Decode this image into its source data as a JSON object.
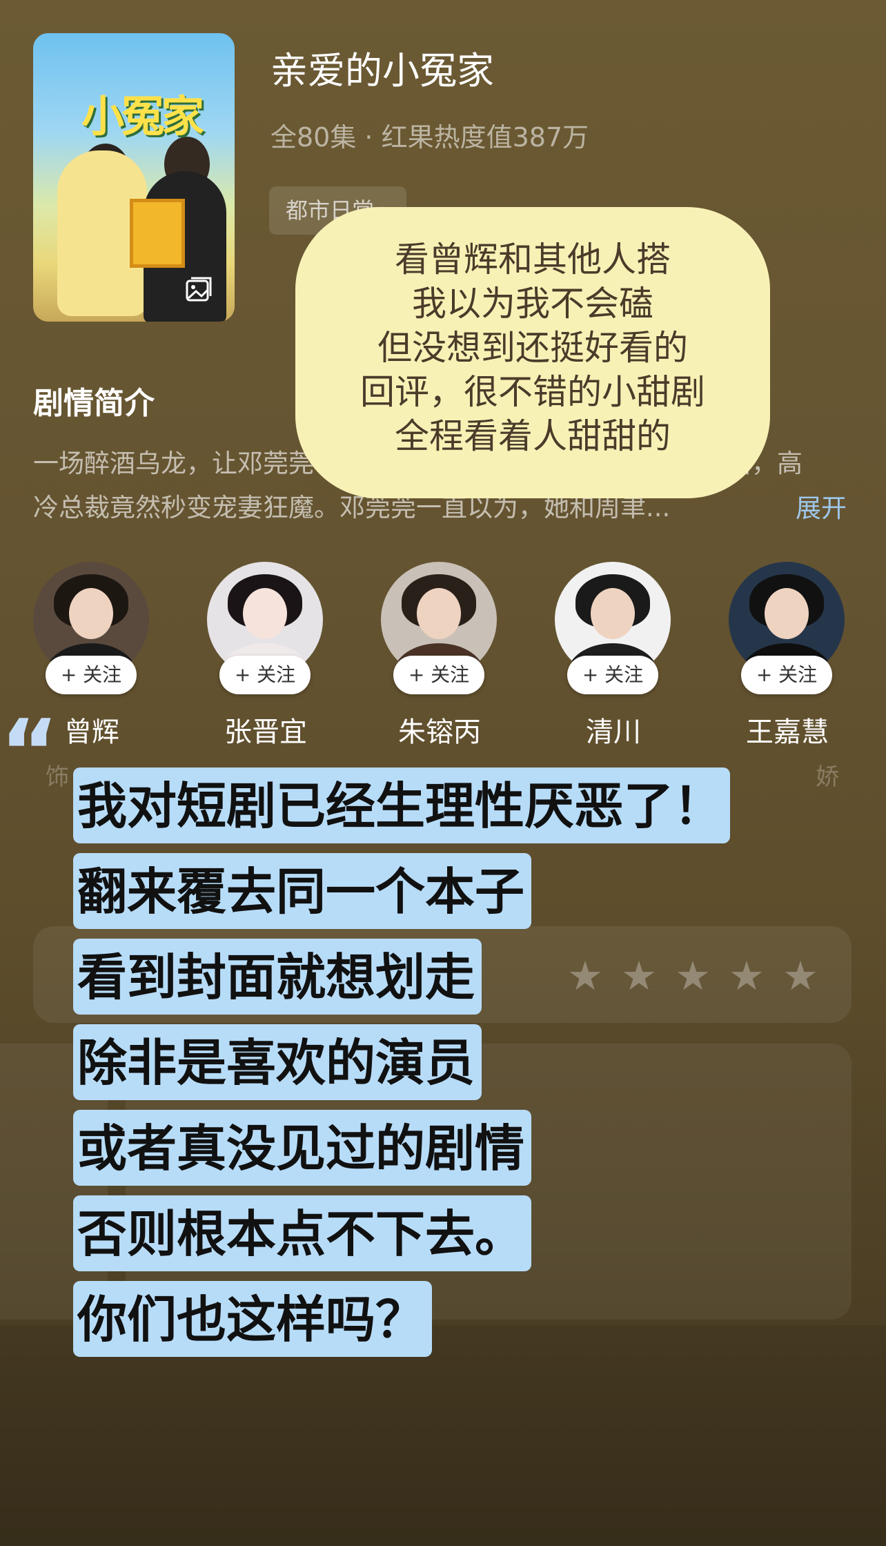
{
  "drama": {
    "title": "亲爱的小冤家",
    "meta": "全80集 · 红果热度值387万",
    "tag": "都市日常 ›",
    "poster_text": "小冤家"
  },
  "synopsis": {
    "heading": "剧情简介",
    "line1": "一场醉酒乌龙，让邓莞莞",
    "line1_end": "婚后，高",
    "line2": "冷总裁竟然秒变宠妻狂魔。邓莞莞一直以为，她和周聿...",
    "expand": "展开"
  },
  "bubble": {
    "lines": [
      "看曾辉和其他人搭",
      "我以为我不会磕",
      "但没想到还挺好看的",
      "回评，很不错的小甜剧",
      "全程看着人甜甜的"
    ]
  },
  "cast": [
    {
      "name": "曾辉",
      "follow": "+ 关注"
    },
    {
      "name": "张晋宜",
      "follow": "+ 关注"
    },
    {
      "name": "朱镕丙",
      "follow": "+ 关注"
    },
    {
      "name": "清川",
      "follow": "+ 关注"
    },
    {
      "name": "王嘉慧",
      "follow": "+ 关注"
    }
  ],
  "faded": {
    "left": "饰",
    "right": "娇"
  },
  "overlay": {
    "quote": "“",
    "lines": [
      "我对短剧已经生理性厌恶了！",
      "翻来覆去同一个本子",
      "看到封面就想划走",
      "除非是喜欢的演员",
      "或者真没见过的剧情",
      "否则根本点不下去。",
      "你们也这样吗？"
    ]
  },
  "rating": {
    "stars": "★★★★★"
  },
  "colors": {
    "background": "#655431",
    "bubble": "#f8f1b6",
    "highlight": "#b7dcf8",
    "expand": "#9ec7ea"
  }
}
